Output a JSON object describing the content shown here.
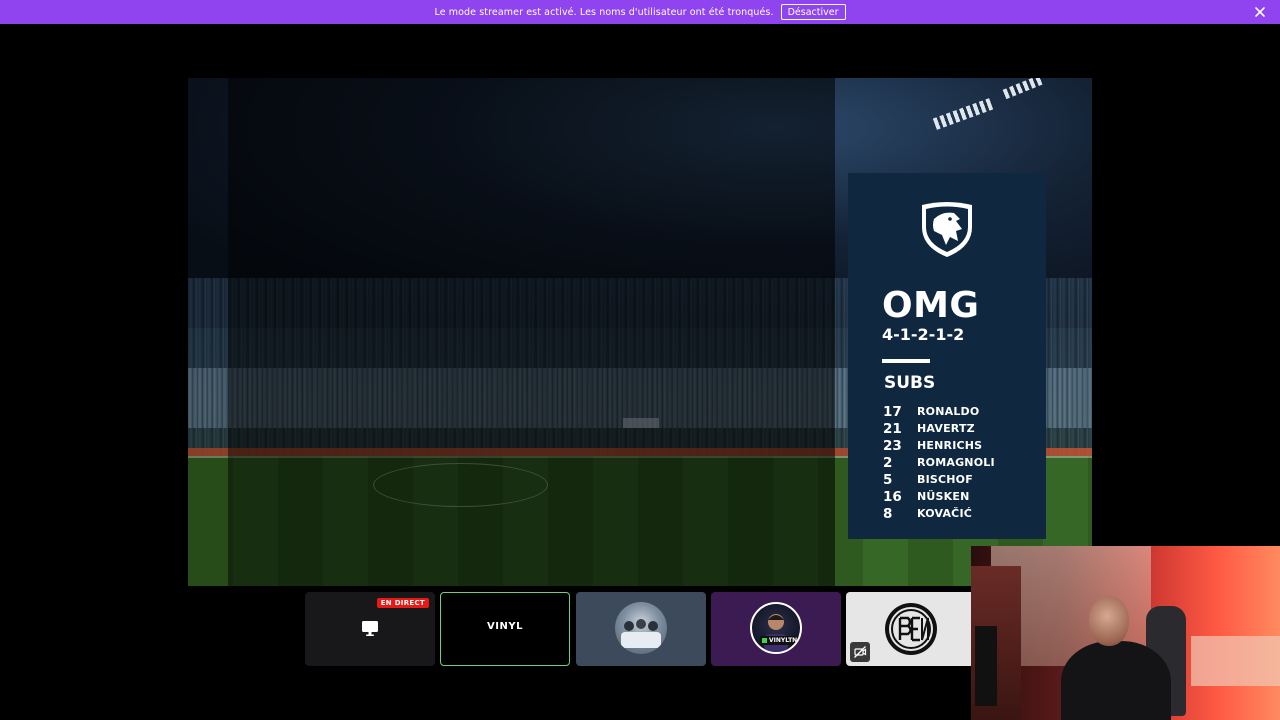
{
  "notice": {
    "text": "Le mode streamer est activé. Les noms d'utilisateur ont été tronqués.",
    "button_label": "Désactiver"
  },
  "lineup": {
    "title": "OMG",
    "formation": "4-1-2-1-2",
    "subs_label": "SUBS",
    "subs": [
      {
        "number": "17",
        "name": "RONALDO"
      },
      {
        "number": "21",
        "name": "HAVERTZ"
      },
      {
        "number": "23",
        "name": "HENRICHS"
      },
      {
        "number": "2",
        "name": "ROMAGNOLI"
      },
      {
        "number": "5",
        "name": "BISCHOF"
      },
      {
        "number": "16",
        "name": "NÜSKEN"
      },
      {
        "number": "8",
        "name": "KOVAČIĆ"
      }
    ]
  },
  "cards": {
    "live_badge": "EN DIRECT",
    "vinyl_label": "VINYL",
    "avatar_label": "VINYLTN"
  },
  "colors": {
    "notice_bar": "#8f44f0",
    "live_badge": "#e91916",
    "active_card_border": "#6fcf86",
    "lineup_panel": "#0f2840"
  }
}
